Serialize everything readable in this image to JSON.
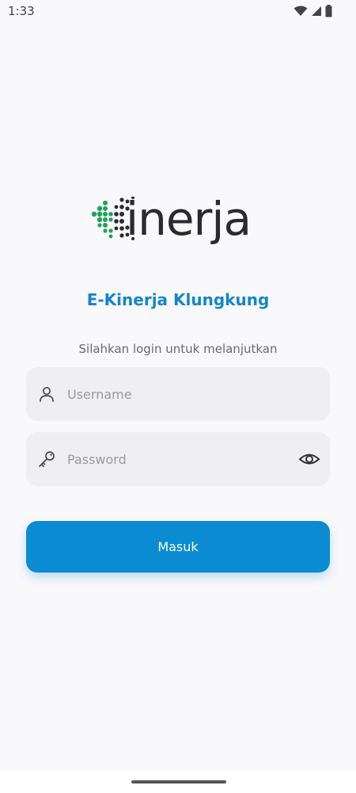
{
  "status_bar": {
    "time": "1:33",
    "icons": [
      "wifi-icon",
      "signal-icon",
      "battery-icon"
    ]
  },
  "logo": {
    "text": "inerja",
    "colors": {
      "green": "#1fa35a",
      "dark": "#2b2b2b"
    }
  },
  "app_title": "E-Kinerja Klungkung",
  "subtitle": "Silahkan login untuk melanjutkan",
  "username": {
    "placeholder": "Username",
    "value": "",
    "icon": "user-icon"
  },
  "password": {
    "placeholder": "Password",
    "value": "",
    "icon": "key-icon",
    "toggle_icon": "eye-icon"
  },
  "login_button": {
    "label": "Masuk"
  },
  "colors": {
    "accent": "#0a8bd2",
    "title": "#1486c9",
    "field_bg": "#efeef1",
    "page_bg": "#f9f8fb"
  }
}
